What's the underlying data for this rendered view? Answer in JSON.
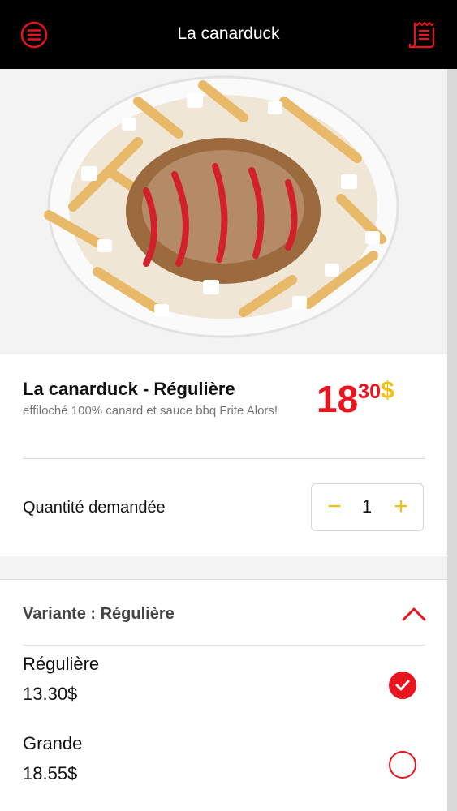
{
  "header": {
    "title": "La canarduck",
    "menu_icon": "menu-icon",
    "receipt_icon": "receipt-icon"
  },
  "product": {
    "name": "La canarduck - Régulière",
    "description": "effiloché 100% canard et sauce bbq Frite Alors!",
    "price_main": "18",
    "price_cents": "30",
    "price_currency": "$"
  },
  "quantity": {
    "label": "Quantité demandée",
    "value": "1",
    "minus": "−",
    "plus": "+"
  },
  "variant": {
    "title": "Variante : Régulière",
    "options": [
      {
        "name": "Régulière",
        "price": "13.30$",
        "selected": true
      },
      {
        "name": "Grande",
        "price": "18.55$",
        "selected": false
      }
    ]
  },
  "colors": {
    "accent": "#e8141e",
    "yellow": "#f4c20d",
    "topbar": "#000000"
  }
}
